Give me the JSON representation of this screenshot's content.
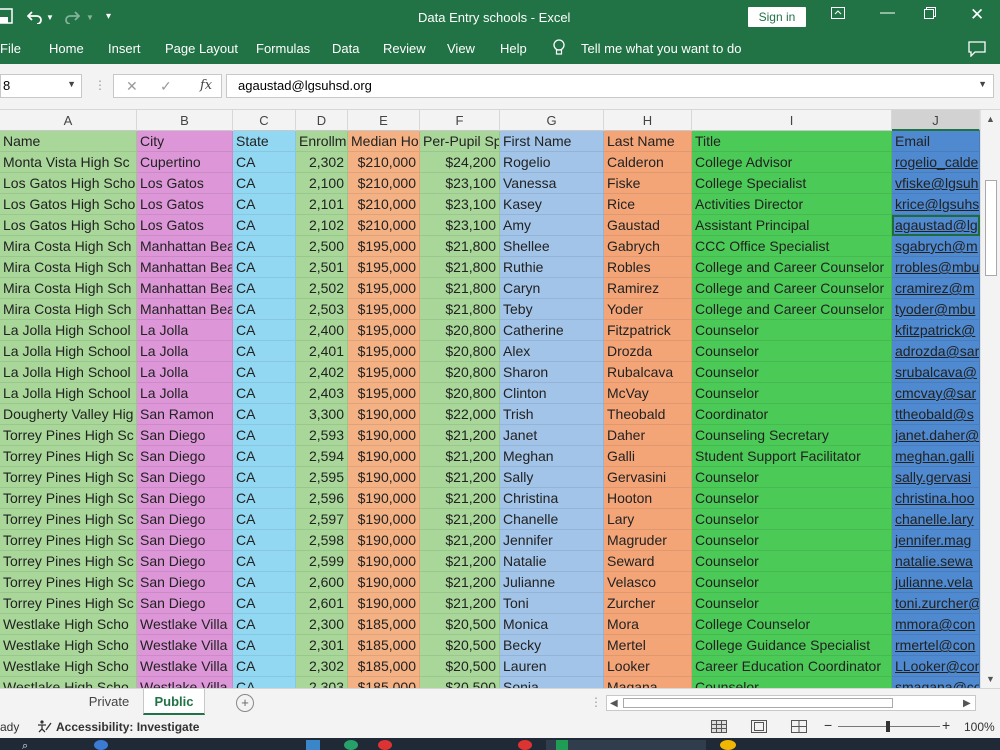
{
  "window": {
    "title": "Data Entry schools  -  Excel",
    "signin": "Sign in"
  },
  "menu": [
    "File",
    "Home",
    "Insert",
    "Page Layout",
    "Formulas",
    "Data",
    "Review",
    "View",
    "Help"
  ],
  "tellme": "Tell me what you want to do",
  "namebox": "8",
  "formula": "agaustad@lgsuhsd.org",
  "fx": "fx",
  "columns": [
    "A",
    "B",
    "C",
    "D",
    "E",
    "F",
    "G",
    "H",
    "I",
    "J"
  ],
  "selected_column": "J",
  "headers": [
    "Name",
    "City",
    "State",
    "Enrollm",
    "Median Ho",
    "Per-Pupil Sp",
    "First Name",
    "Last Name",
    "Title",
    "Email"
  ],
  "column_colors": [
    "#a9d79a",
    "#dd97d8",
    "#93d8f2",
    "#a9d79a",
    "#f4b184",
    "#a9d79a",
    "#a2c4e8",
    "#f4a578",
    "#4cca57",
    "#4f89cf"
  ],
  "rows": [
    [
      "Monta Vista High Sc",
      "Cupertino",
      "CA",
      "2,302",
      "$210,000",
      "$24,200",
      "Rogelio",
      "Calderon",
      "College Advisor",
      "rogelio_calde"
    ],
    [
      "Los Gatos High Scho",
      "Los Gatos",
      "CA",
      "2,100",
      "$210,000",
      "$23,100",
      "Vanessa",
      "Fiske",
      "College Specialist",
      "vfiske@lgsuh"
    ],
    [
      "Los Gatos High Scho",
      "Los Gatos",
      "CA",
      "2,101",
      "$210,000",
      "$23,100",
      "Kasey",
      "Rice",
      "Activities Director",
      "krice@lgsuhs"
    ],
    [
      "Los Gatos High Scho",
      "Los Gatos",
      "CA",
      "2,102",
      "$210,000",
      "$23,100",
      "Amy",
      "Gaustad",
      "Assistant Principal",
      "agaustad@lg"
    ],
    [
      "Mira Costa High Sch",
      "Manhattan Bea",
      "CA",
      "2,500",
      "$195,000",
      "$21,800",
      "Shellee",
      "Gabrych",
      "CCC Office Specialist",
      "sgabrych@m"
    ],
    [
      "Mira Costa High Sch",
      "Manhattan Bea",
      "CA",
      "2,501",
      "$195,000",
      "$21,800",
      "Ruthie",
      "Robles",
      "College and Career Counselor",
      "rrobles@mbu"
    ],
    [
      "Mira Costa High Sch",
      "Manhattan Bea",
      "CA",
      "2,502",
      "$195,000",
      "$21,800",
      "Caryn",
      "Ramirez",
      "College and Career Counselor",
      "cramirez@m"
    ],
    [
      "Mira Costa High Sch",
      "Manhattan Bea",
      "CA",
      "2,503",
      "$195,000",
      "$21,800",
      "Teby",
      "Yoder",
      "College and Career Counselor",
      "tyoder@mbu"
    ],
    [
      "La Jolla High School",
      "La Jolla",
      "CA",
      "2,400",
      "$195,000",
      "$20,800",
      "Catherine",
      "Fitzpatrick",
      "Counselor",
      "kfitzpatrick@"
    ],
    [
      "La Jolla High School",
      "La Jolla",
      "CA",
      "2,401",
      "$195,000",
      "$20,800",
      "Alex",
      "Drozda",
      "Counselor",
      "adrozda@sar"
    ],
    [
      "La Jolla High School",
      "La Jolla",
      "CA",
      "2,402",
      "$195,000",
      "$20,800",
      "Sharon",
      "Rubalcava",
      "Counselor",
      "srubalcava@"
    ],
    [
      "La Jolla High School",
      "La Jolla",
      "CA",
      "2,403",
      "$195,000",
      "$20,800",
      "Clinton",
      "McVay",
      "Counselor",
      "cmcvay@sar"
    ],
    [
      "Dougherty Valley Hig",
      "San Ramon",
      "CA",
      "3,300",
      "$190,000",
      "$22,000",
      "Trish",
      "Theobald",
      "Coordinator",
      "ttheobald@s"
    ],
    [
      "Torrey Pines High Sc",
      "San Diego",
      "CA",
      "2,593",
      "$190,000",
      "$21,200",
      "Janet",
      "Daher",
      "Counseling Secretary",
      "janet.daher@"
    ],
    [
      "Torrey Pines High Sc",
      "San Diego",
      "CA",
      "2,594",
      "$190,000",
      "$21,200",
      "Meghan",
      "Galli",
      "Student Support Facilitator",
      "meghan.galli"
    ],
    [
      "Torrey Pines High Sc",
      "San Diego",
      "CA",
      "2,595",
      "$190,000",
      "$21,200",
      "Sally",
      "Gervasini",
      "Counselor",
      "sally.gervasi"
    ],
    [
      "Torrey Pines High Sc",
      "San Diego",
      "CA",
      "2,596",
      "$190,000",
      "$21,200",
      "Christina",
      "Hooton",
      "Counselor",
      "christina.hoo"
    ],
    [
      "Torrey Pines High Sc",
      "San Diego",
      "CA",
      "2,597",
      "$190,000",
      "$21,200",
      "Chanelle",
      "Lary",
      "Counselor",
      "chanelle.lary"
    ],
    [
      "Torrey Pines High Sc",
      "San Diego",
      "CA",
      "2,598",
      "$190,000",
      "$21,200",
      "Jennifer",
      "Magruder",
      "Counselor",
      "jennifer.mag"
    ],
    [
      "Torrey Pines High Sc",
      "San Diego",
      "CA",
      "2,599",
      "$190,000",
      "$21,200",
      "Natalie",
      "Seward",
      "Counselor",
      "natalie.sewa"
    ],
    [
      "Torrey Pines High Sc",
      "San Diego",
      "CA",
      "2,600",
      "$190,000",
      "$21,200",
      "Julianne",
      "Velasco",
      "Counselor",
      "julianne.vela"
    ],
    [
      "Torrey Pines High Sc",
      "San Diego",
      "CA",
      "2,601",
      "$190,000",
      "$21,200",
      "Toni",
      "Zurcher",
      "Counselor",
      "toni.zurcher@"
    ],
    [
      "Westlake High Scho",
      "Westlake Villa",
      "CA",
      "2,300",
      "$185,000",
      "$20,500",
      "Monica",
      "Mora",
      "College Counselor",
      "mmora@con"
    ],
    [
      "Westlake High Scho",
      "Westlake Villa",
      "CA",
      "2,301",
      "$185,000",
      "$20,500",
      "Becky",
      "Mertel",
      "College Guidance Specialist",
      "rmertel@con"
    ],
    [
      "Westlake High Scho",
      "Westlake Villa",
      "CA",
      "2,302",
      "$185,000",
      "$20,500",
      "Lauren",
      "Looker",
      "Career Education Coordinator",
      "LLooker@con"
    ],
    [
      "Westlake High Scho",
      "Westlake Villa",
      "CA",
      "2,303",
      "$185,000",
      "$20,500",
      "Sonia",
      "Magana",
      "Counselor",
      "smagana@co"
    ]
  ],
  "active_cell": {
    "row": 3,
    "col": 9
  },
  "sheets": [
    "Private",
    "Public"
  ],
  "active_sheet": "Public",
  "status": {
    "mode": "ady",
    "accessibility": "Accessibility: Investigate",
    "zoom": "100%",
    "zoom_minus": "−",
    "zoom_plus": "+"
  }
}
